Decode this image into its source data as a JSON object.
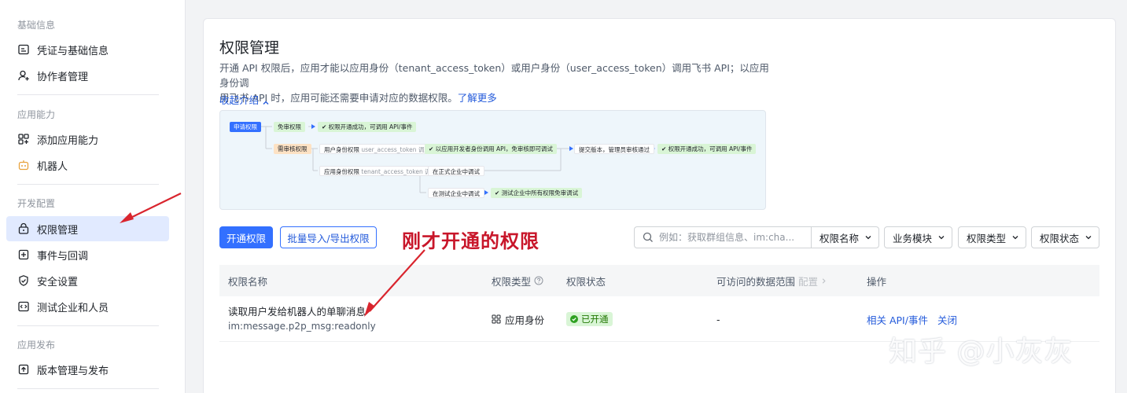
{
  "sidebar": {
    "groups": [
      {
        "label": "基础信息"
      },
      {
        "label": "应用能力"
      },
      {
        "label": "开发配置"
      },
      {
        "label": "应用发布"
      }
    ],
    "items": [
      {
        "label": "凭证与基础信息",
        "icon": "credential-icon"
      },
      {
        "label": "协作者管理",
        "icon": "user-plus-icon"
      },
      {
        "label": "添加应用能力",
        "icon": "grid-add-icon"
      },
      {
        "label": "机器人",
        "icon": "robot-icon"
      },
      {
        "label": "权限管理",
        "icon": "lock-icon",
        "active": true
      },
      {
        "label": "事件与回调",
        "icon": "event-icon"
      },
      {
        "label": "安全设置",
        "icon": "shield-icon"
      },
      {
        "label": "测试企业和人员",
        "icon": "code-icon"
      },
      {
        "label": "版本管理与发布",
        "icon": "upload-icon"
      }
    ]
  },
  "main": {
    "title": "权限管理",
    "desc_line1": "开通 API 权限后，应用才能以应用身份（tenant_access_token）或用户身份（user_access_token）调用飞书 API；以应用身份调",
    "desc_line2": "用飞书 API 时，应用可能还需要申请对应的数据权限。",
    "learn_more": "了解更多",
    "collapse": "收起介绍"
  },
  "flow": {
    "apply": "申请权限",
    "free": "免审权限",
    "free_ok": "权限开通成功，可调用 API/事件",
    "need": "需审核权限",
    "user_perm": "用户身份权限",
    "user_token": "user_access_token 调用",
    "dev_debug": "以应用开发者身份调用 API，免审核即可调试",
    "submit": "提交版本，管理员审核通过",
    "final_ok": "权限开通成功，可调用 API/事件",
    "app_perm": "应用身份权限",
    "tenant_token": "tenant_access_token 调用",
    "formal_debug": "在正式企业中调试",
    "test_debug": "在测试企业中调试",
    "test_free": "测试企业中所有权限免审调试"
  },
  "toolbar": {
    "open_btn": "开通权限",
    "batch_btn": "批量导入/导出权限",
    "search_placeholder": "例如：获取群组信息、im:cha...",
    "filters": [
      "权限名称",
      "业务模块",
      "权限类型",
      "权限状态"
    ]
  },
  "annotation": "刚才开通的权限",
  "table": {
    "headers": {
      "name": "权限名称",
      "type": "权限类型",
      "status": "权限状态",
      "scope": "可访问的数据范围",
      "scope_config": "配置",
      "ops": "操作"
    },
    "rows": [
      {
        "name": "读取用户发给机器人的单聊消息",
        "code": "im:message.p2p_msg:readonly",
        "type": "应用身份",
        "status": "已开通",
        "scope": "-",
        "op_related": "相关 API/事件",
        "op_close": "关闭"
      }
    ]
  },
  "watermark": "知乎 @小灰灰",
  "colors": {
    "accent": "#3370ff",
    "active_bg": "#e1eaff",
    "annotation": "#c8162a",
    "success_bg": "#d9f5d6"
  }
}
